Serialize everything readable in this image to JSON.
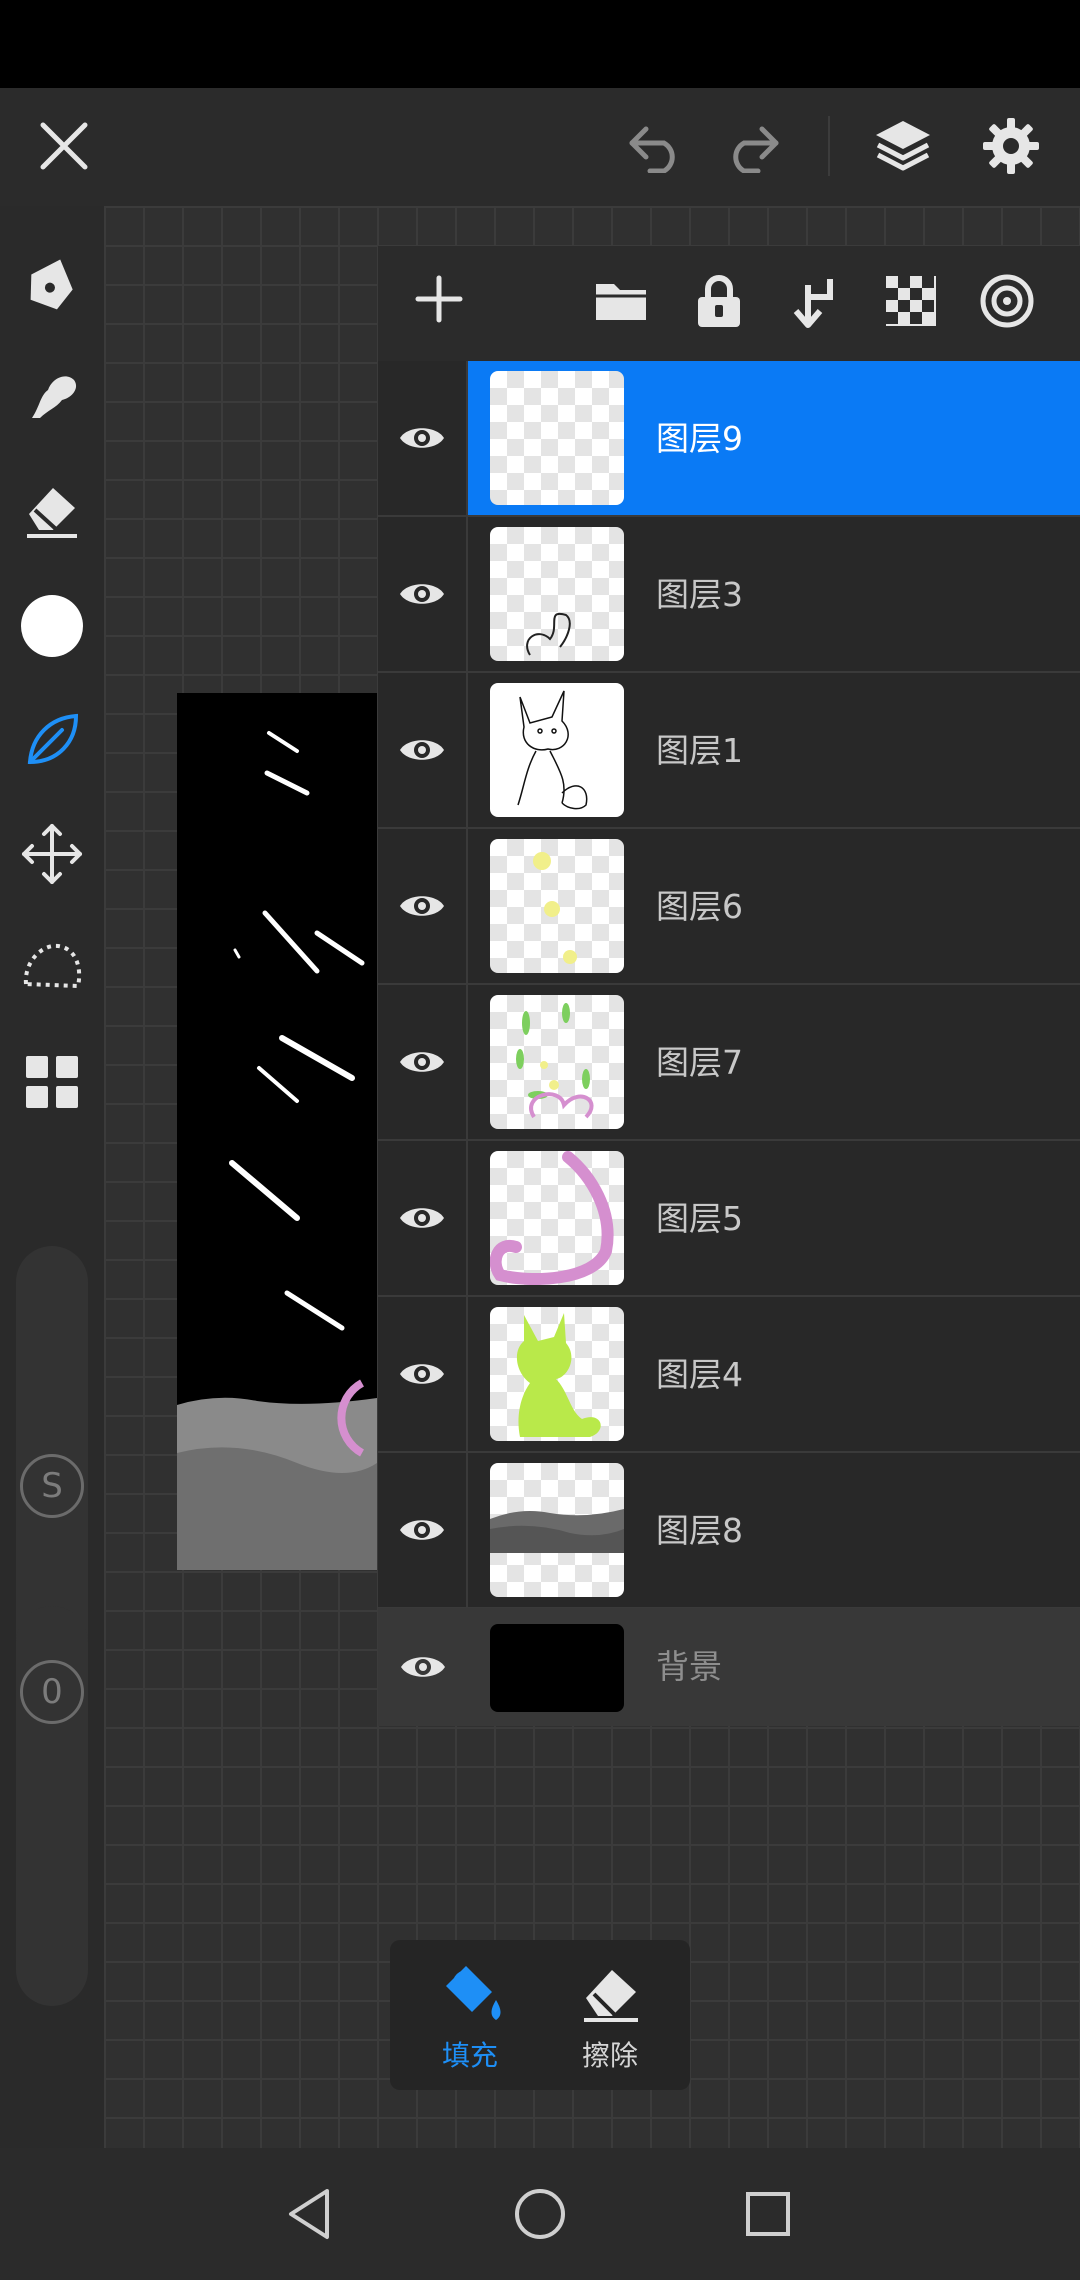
{
  "colors": {
    "accent": "#0a7af5",
    "panel_bg": "#282828",
    "icon": "#e6e6e6"
  },
  "top_bar": {
    "close_icon": "close-icon",
    "undo_icon": "undo-icon",
    "redo_icon": "redo-icon",
    "layers_icon": "layers-icon",
    "settings_icon": "gear-icon"
  },
  "left_toolbar": {
    "tools": [
      "pen-icon",
      "smudge-icon",
      "eraser-icon",
      "color-icon",
      "leaf-brush-icon",
      "move-icon",
      "lasso-icon",
      "grid-icon"
    ],
    "size_slider_label": "S",
    "opacity_slider_label": "0"
  },
  "layers_panel": {
    "toolbar_icons": [
      "add-icon",
      "folder-icon",
      "lock-icon",
      "merge-down-icon",
      "checker-icon",
      "target-icon"
    ],
    "layers": [
      {
        "name": "图层9",
        "selected": true
      },
      {
        "name": "图层3",
        "selected": false
      },
      {
        "name": "图层1",
        "selected": false
      },
      {
        "name": "图层6",
        "selected": false
      },
      {
        "name": "图层7",
        "selected": false
      },
      {
        "name": "图层5",
        "selected": false
      },
      {
        "name": "图层4",
        "selected": false
      },
      {
        "name": "图层8",
        "selected": false
      }
    ],
    "background_layer": {
      "name": "背景"
    }
  },
  "fill_popup": {
    "fill_label": "填充",
    "erase_label": "擦除"
  },
  "nav_bar": {
    "icons": [
      "back-icon",
      "home-icon",
      "recents-icon"
    ]
  }
}
